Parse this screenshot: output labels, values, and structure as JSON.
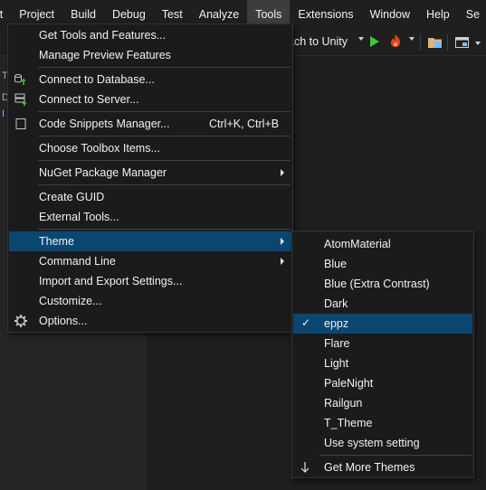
{
  "menubar": {
    "items": [
      "it",
      "Project",
      "Build",
      "Debug",
      "Test",
      "Analyze",
      "Tools",
      "Extensions",
      "Window",
      "Help",
      "Se"
    ]
  },
  "toolbar": {
    "attach_label": "ach to Unity"
  },
  "left_panel": {
    "fragments": [
      "T",
      "D",
      "I"
    ]
  },
  "tools_menu": {
    "items": [
      {
        "label": "Get Tools and Features..."
      },
      {
        "label": "Manage Preview Features"
      },
      {
        "label": "Connect to Database...",
        "icon": "database-connect-icon"
      },
      {
        "label": "Connect to Server...",
        "icon": "server-connect-icon"
      },
      {
        "label": "Code Snippets Manager...",
        "shortcut": "Ctrl+K, Ctrl+B",
        "icon": "snippet-icon"
      },
      {
        "label": "Choose Toolbox Items..."
      },
      {
        "label": "NuGet Package Manager",
        "submenu": true
      },
      {
        "label": "Create GUID"
      },
      {
        "label": "External Tools..."
      },
      {
        "label": "Theme",
        "submenu": true,
        "highlighted": true
      },
      {
        "label": "Command Line",
        "submenu": true
      },
      {
        "label": "Import and Export Settings..."
      },
      {
        "label": "Customize..."
      },
      {
        "label": "Options...",
        "icon": "gear-icon"
      }
    ]
  },
  "theme_menu": {
    "items": [
      {
        "label": "AtomMaterial"
      },
      {
        "label": "Blue"
      },
      {
        "label": "Blue (Extra Contrast)"
      },
      {
        "label": "Dark"
      },
      {
        "label": "eppz",
        "checked": true,
        "highlighted": true
      },
      {
        "label": "Flare"
      },
      {
        "label": "Light"
      },
      {
        "label": "PaleNight"
      },
      {
        "label": "Railgun"
      },
      {
        "label": "T_Theme"
      },
      {
        "label": "Use system setting"
      }
    ],
    "more": {
      "label": "Get More Themes",
      "icon": "arrow-down-icon"
    },
    "check_glyph": "✓"
  },
  "colors": {
    "highlight": "#094771",
    "menu_bg": "#1b1b1c",
    "play_green": "#3ec63e",
    "fire_red": "#e8402a"
  }
}
